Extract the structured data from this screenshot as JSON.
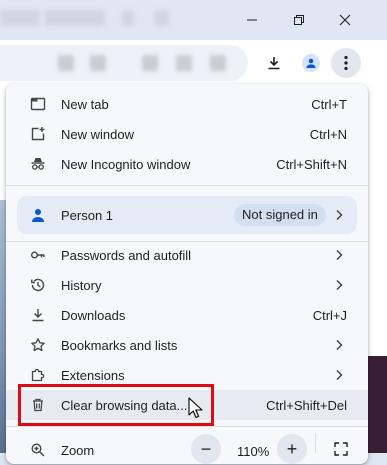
{
  "window": {
    "controls": {
      "minimize": "minimize-icon",
      "restore": "restore-icon",
      "close": "close-icon"
    }
  },
  "toolbar": {
    "download_icon": "download-icon",
    "profile_icon": "person-icon",
    "menu_icon": "kebab-menu-icon"
  },
  "menu": {
    "new_tab": {
      "label": "New tab",
      "shortcut": "Ctrl+T"
    },
    "new_window": {
      "label": "New window",
      "shortcut": "Ctrl+N"
    },
    "new_incognito": {
      "label": "New Incognito window",
      "shortcut": "Ctrl+Shift+N"
    },
    "profile": {
      "label": "Person 1",
      "badge": "Not signed in"
    },
    "passwords": {
      "label": "Passwords and autofill"
    },
    "history": {
      "label": "History"
    },
    "downloads": {
      "label": "Downloads",
      "shortcut": "Ctrl+J"
    },
    "bookmarks": {
      "label": "Bookmarks and lists"
    },
    "extensions": {
      "label": "Extensions"
    },
    "clear_browsing": {
      "label": "Clear browsing data...",
      "shortcut": "Ctrl+Shift+Del"
    },
    "zoom": {
      "label": "Zoom",
      "value": "110%",
      "minus": "−",
      "plus": "+"
    }
  },
  "colors": {
    "highlight_box": "#e00b12",
    "menu_bg": "#f6f8fc",
    "profile_bg": "#e4ebf6"
  }
}
